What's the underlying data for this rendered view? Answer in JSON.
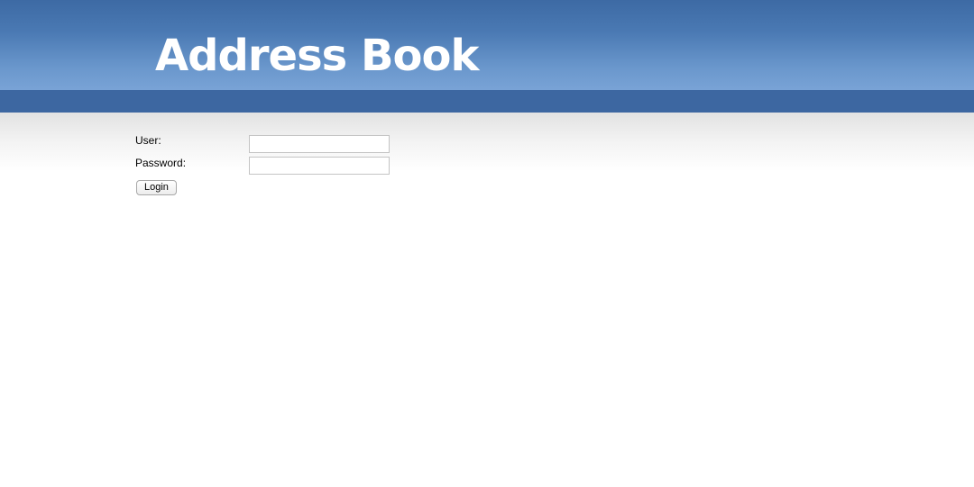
{
  "header": {
    "title": "Address Book"
  },
  "login": {
    "user_label": "User:",
    "user_value": "",
    "password_label": "Password:",
    "password_value": "",
    "login_button": "Login"
  },
  "colors": {
    "header_top": "#3d6aa4",
    "header_bottom": "#79a3d6",
    "nav_band": "#3d67a1"
  }
}
